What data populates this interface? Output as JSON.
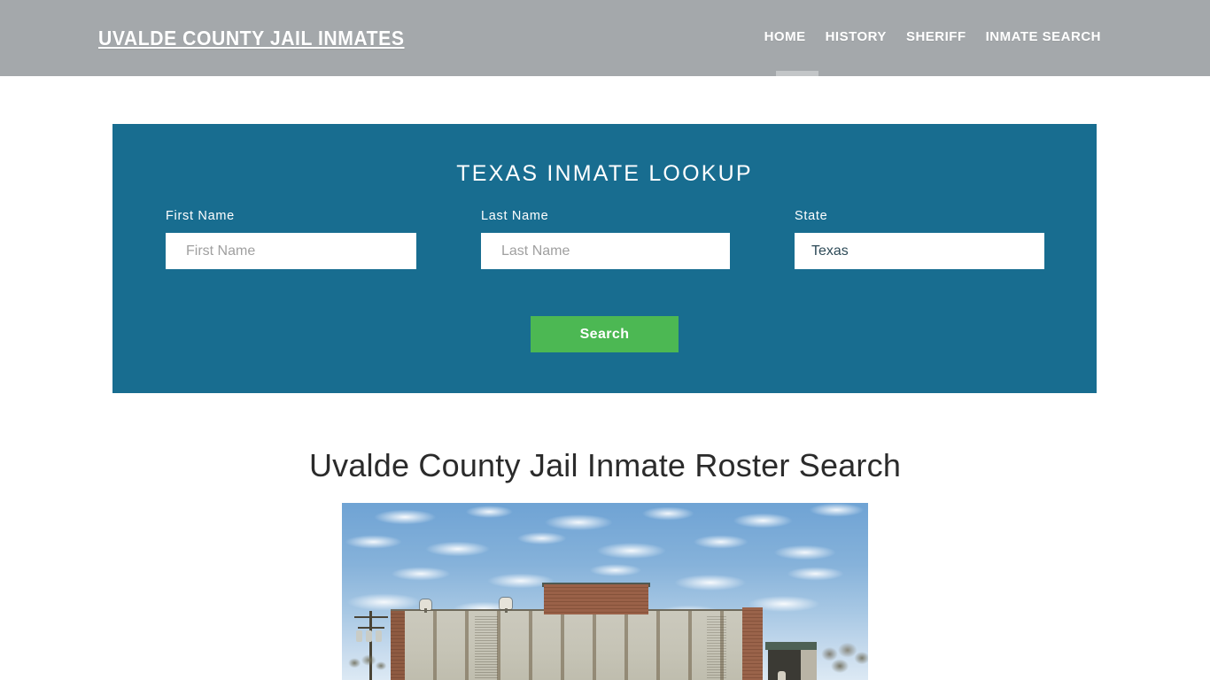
{
  "header": {
    "brand": "UVALDE COUNTY JAIL INMATES",
    "nav": [
      {
        "label": "HOME",
        "active": true
      },
      {
        "label": "HISTORY",
        "active": false
      },
      {
        "label": "SHERIFF",
        "active": false
      },
      {
        "label": "INMATE SEARCH",
        "active": false
      }
    ],
    "background_color": "#a4a8ab",
    "active_indicator_color": "#c3c6c8"
  },
  "lookup": {
    "title": "TEXAS INMATE LOOKUP",
    "panel_color": "#186d90",
    "fields": {
      "first_name": {
        "label": "First Name",
        "placeholder": "First Name",
        "value": ""
      },
      "last_name": {
        "label": "Last Name",
        "placeholder": "Last Name",
        "value": ""
      },
      "state": {
        "label": "State",
        "value": "Texas",
        "options": [
          "Texas"
        ]
      }
    },
    "search_button": {
      "label": "Search",
      "color": "#4cb853"
    }
  },
  "main": {
    "heading": "Uvalde County Jail Inmate Roster Search",
    "photo": {
      "name": "uvalde-county-jail-building-photo",
      "description": "Exterior photo of the Uvalde County Jail building with concrete panel walls, brick accents and a partly cloudy blue sky"
    }
  }
}
